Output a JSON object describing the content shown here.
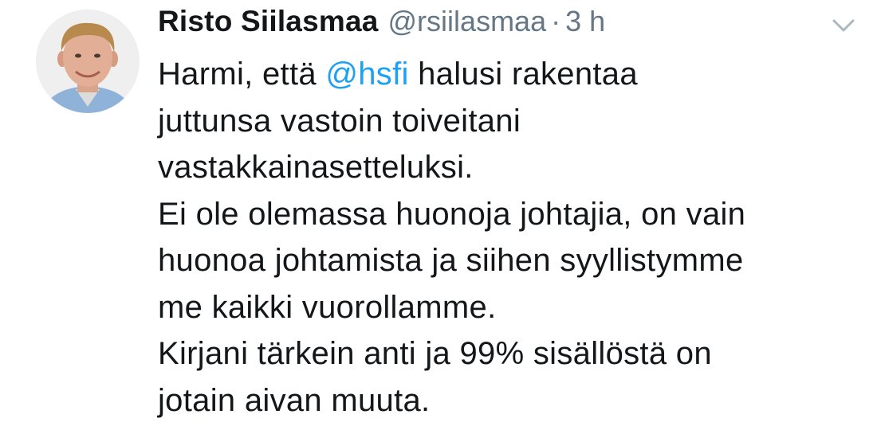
{
  "tweet": {
    "author_name": "Risto Siilasmaa",
    "author_handle": "@rsiilasmaa",
    "separator": "·",
    "time": "3 h",
    "caret_icon": "chevron-down-icon",
    "avatar_icon": "profile-photo",
    "lines": [
      {
        "before": "Harmi, että ",
        "mention": "@hsfi",
        "after": " halusi rakentaa"
      },
      {
        "text": "juttunsa vastoin toiveitani"
      },
      {
        "text": "vastakkainasetteluksi."
      },
      {
        "text": "Ei ole olemassa huonoja johtajia, on vain"
      },
      {
        "text": "huonoa johtamista ja siihen syyllistymme"
      },
      {
        "text": "me kaikki vuorollamme."
      },
      {
        "text": "Kirjani tärkein anti ja 99% sisällöstä on"
      },
      {
        "text": "jotain aivan muuta."
      }
    ],
    "colors": {
      "text": "#14171a",
      "muted": "#657786",
      "link": "#1da1f2"
    }
  }
}
